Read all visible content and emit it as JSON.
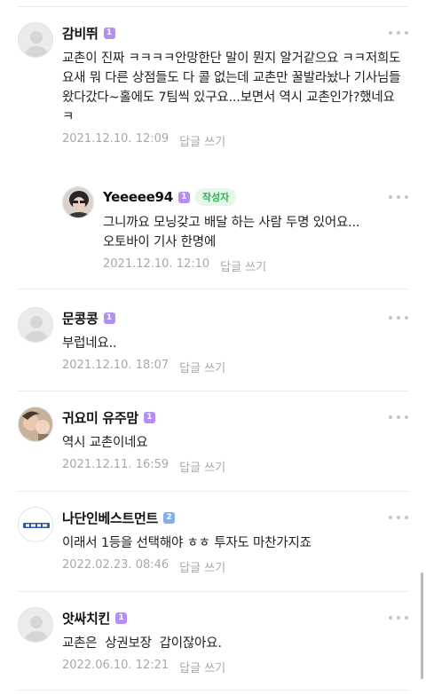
{
  "comments": [
    {
      "author": "감비뛰",
      "level": "1",
      "text": "교촌이 진짜 ㅋㅋㅋㅋ안망한단 말이 뭔지 알거같으요 ㅋㅋ저희도 요새 뭐 다른 상점들도 다 콜 없는데 교촌만 꿀발라놨나 기사님들 왔다갔다~홀에도 7팀씩 있구요...보면서 역시 교촌인가?했네요 ㅋ",
      "date": "2021.12.10. 12:09",
      "reply_label": "답글 쓰기"
    },
    {
      "author": "Yeeeee94",
      "level": "1",
      "author_tag": "작성자",
      "text": "그니까요 모닝갖고 배달 하는 사람 두명 있어요... 오토바이 기사 한명에",
      "date": "2021.12.10. 12:10",
      "reply_label": "답글 쓰기"
    },
    {
      "author": "문콩콩",
      "level": "1",
      "text": "부럽네요..",
      "date": "2021.12.10. 18:07",
      "reply_label": "답글 쓰기"
    },
    {
      "author": "귀요미 유주맘",
      "level": "1",
      "text": "역시 교촌이네요",
      "date": "2021.12.11. 16:59",
      "reply_label": "답글 쓰기"
    },
    {
      "author": "나단인베스트먼트",
      "level": "2",
      "text": "이래서 1등을 선택해야 ㅎㅎ 투자도 마찬가지죠",
      "date": "2022.02.23. 08:46",
      "reply_label": "답글 쓰기"
    },
    {
      "author": "앗싸치킨",
      "level": "1",
      "text": "교촌은  상권보장  갑이잖아요.",
      "date": "2022.06.10. 12:21",
      "reply_label": "답글 쓰기"
    }
  ],
  "icons": {
    "more": "more-dots-icon",
    "default_avatar": "default-avatar-icon"
  },
  "colors": {
    "author_tag_text": "#2ab34f",
    "author_tag_bg": "#e6f6e9",
    "level_badge": "#b190f2",
    "level_badge_2": "#7fb0f0",
    "meta_text": "#a8a8a8"
  }
}
